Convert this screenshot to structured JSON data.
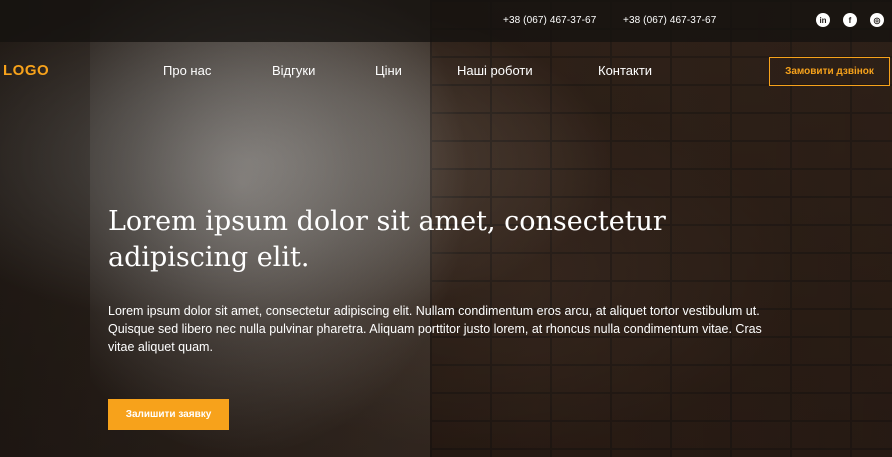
{
  "topbar": {
    "phones": [
      "+38 (067) 467-37-67",
      "+38 (067) 467-37-67"
    ],
    "social": [
      {
        "icon": "linkedin-icon",
        "glyph": "in"
      },
      {
        "icon": "facebook-icon",
        "glyph": "f"
      },
      {
        "icon": "instagram-icon",
        "glyph": "◎"
      }
    ]
  },
  "header": {
    "logo": "LOGO",
    "nav": [
      "Про нас",
      "Відгуки",
      "Ціни",
      "Наші роботи",
      "Контакти"
    ],
    "callback_label": "Замовити дзвінок"
  },
  "hero": {
    "title": "Lorem ipsum dolor sit amet, consectetur adipiscing elit.",
    "text": "Lorem ipsum dolor sit amet, consectetur adipiscing elit. Nullam condimentum eros arcu, at aliquet tortor vestibulum ut. Quisque sed libero nec nulla pulvinar pharetra. Aliquam porttitor justo lorem, at rhoncus nulla condimentum vitae. Cras vitae aliquet quam.",
    "cta_label": "Залишити заявку"
  },
  "colors": {
    "accent": "#f7a21b",
    "topbar": "#141210"
  }
}
